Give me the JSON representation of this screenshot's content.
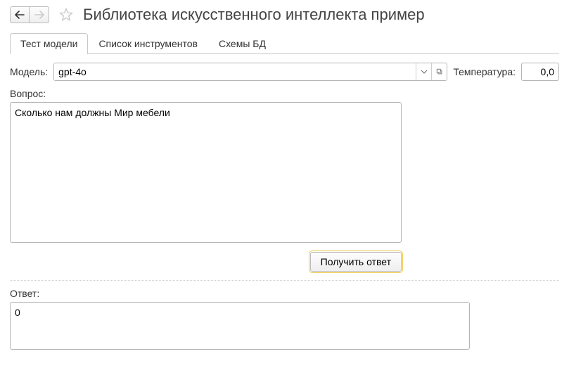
{
  "header": {
    "title": "Библиотека искусственного интеллекта пример"
  },
  "tabs": [
    {
      "label": "Тест модели",
      "active": true
    },
    {
      "label": "Список инструментов",
      "active": false
    },
    {
      "label": "Схемы БД",
      "active": false
    }
  ],
  "form": {
    "model_label": "Модель:",
    "model_value": "gpt-4o",
    "temperature_label": "Температура:",
    "temperature_value": "0,0",
    "question_label": "Вопрос:",
    "question_value": "Сколько нам должны Мир мебели",
    "submit_label": "Получить ответ",
    "answer_label": "Ответ:",
    "answer_value": "0"
  }
}
